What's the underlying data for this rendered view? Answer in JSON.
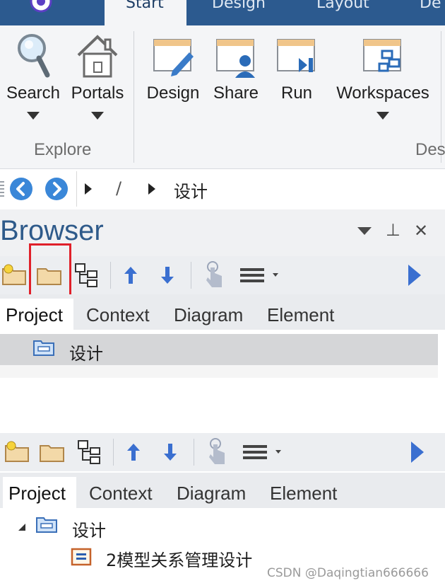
{
  "ribbon": {
    "tabs": [
      {
        "label": "Start"
      },
      {
        "label": "Design"
      },
      {
        "label": "Layout"
      },
      {
        "label": "De"
      }
    ],
    "buttons": [
      {
        "label": "Search",
        "icon": "magnifier-icon"
      },
      {
        "label": "Portals",
        "icon": "house-icon"
      },
      {
        "label": "Design",
        "icon": "design-pencil-icon"
      },
      {
        "label": "Share",
        "icon": "share-person-icon"
      },
      {
        "label": "Run",
        "icon": "run-play-icon"
      },
      {
        "label": "Workspaces",
        "icon": "workspaces-icon"
      }
    ],
    "group_explore": "Explore",
    "group_design_partial": "Des"
  },
  "breadcrumb": {
    "separator": "/",
    "current": "设计"
  },
  "browser": {
    "title": "Browser",
    "pin_glyph": "⊥",
    "close_glyph": "✕",
    "tabs": [
      "Project",
      "Context",
      "Diagram",
      "Element"
    ],
    "root_item": "设计",
    "child_item": "2模型关系管理设计"
  },
  "watermark": "CSDN @Daqingtian666666",
  "colors": {
    "ribbon_tabbar": "#2c5a8f",
    "accent_blue": "#3a87d8",
    "highlight_red": "#e0202a",
    "folder_fill": "#f3d9a8"
  }
}
